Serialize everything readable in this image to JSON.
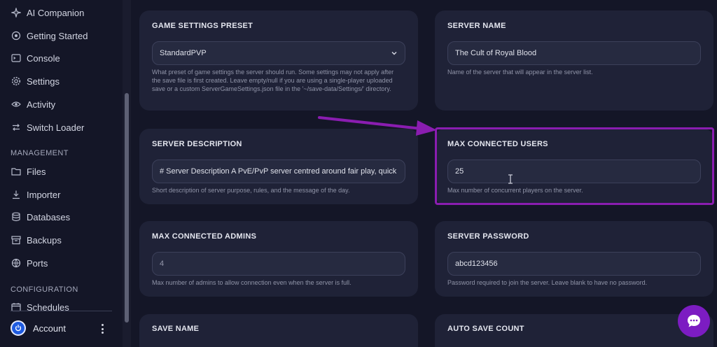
{
  "sidebar": {
    "items": [
      {
        "label": "AI Companion",
        "icon": "sparkle-icon"
      },
      {
        "label": "Getting Started",
        "icon": "rocket-icon"
      },
      {
        "label": "Console",
        "icon": "terminal-icon"
      },
      {
        "label": "Settings",
        "icon": "gear-icon"
      },
      {
        "label": "Activity",
        "icon": "eye-icon"
      },
      {
        "label": "Switch Loader",
        "icon": "swap-icon"
      }
    ],
    "management_heading": "MANAGEMENT",
    "management_items": [
      {
        "label": "Files",
        "icon": "folder-icon"
      },
      {
        "label": "Importer",
        "icon": "download-icon"
      },
      {
        "label": "Databases",
        "icon": "database-icon"
      },
      {
        "label": "Backups",
        "icon": "archive-icon"
      },
      {
        "label": "Ports",
        "icon": "network-icon"
      }
    ],
    "configuration_heading": "CONFIGURATION",
    "configuration_items": [
      {
        "label": "Schedules",
        "icon": "calendar-icon"
      }
    ],
    "account_label": "Account"
  },
  "settings": {
    "preset": {
      "label": "GAME SETTINGS PRESET",
      "value": "StandardPVP",
      "help": "What preset of game settings the server should run. Some settings may not apply after the save file is first created. Leave empty/null if you are using a single-player uploaded save or a custom ServerGameSettings.json file in the '~/save-data/Settings/' directory."
    },
    "server_name": {
      "label": "SERVER NAME",
      "value": "The Cult of Royal Blood",
      "help": "Name of the server that will appear in the server list."
    },
    "description": {
      "label": "SERVER DESCRIPTION",
      "value": "# Server Description A PvE/PvP server centred around fair play, quick",
      "help": "Short description of server purpose, rules, and the message of the day."
    },
    "max_users": {
      "label": "MAX CONNECTED USERS",
      "value": "25",
      "help": "Max number of concurrent players on the server."
    },
    "max_admins": {
      "label": "MAX CONNECTED ADMINS",
      "value": "4",
      "help": "Max number of admins to allow connection even when the server is full."
    },
    "password": {
      "label": "SERVER PASSWORD",
      "value": "abcd123456",
      "help": "Password required to join the server. Leave blank to have no password."
    },
    "save_name": {
      "label": "SAVE NAME"
    },
    "auto_save": {
      "label": "AUTO SAVE COUNT"
    }
  },
  "colors": {
    "accent": "#8a1db0",
    "chat": "#7c1cc2",
    "card": "#1f2237",
    "background": "#141627"
  }
}
